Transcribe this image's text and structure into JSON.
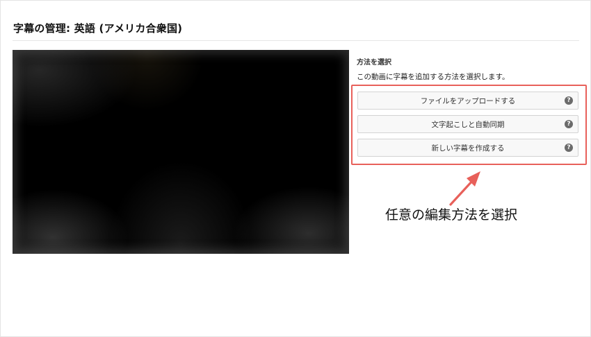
{
  "page": {
    "title": "字幕の管理: 英語 (アメリカ合衆国)"
  },
  "panel": {
    "heading": "方法を選択",
    "description": "この動画に字幕を追加する方法を選択します。",
    "options": [
      {
        "label": "ファイルをアップロードする",
        "icon": "question-mark-icon"
      },
      {
        "label": "文字起こしと自動同期",
        "icon": "question-mark-icon"
      },
      {
        "label": "新しい字幕を作成する",
        "icon": "question-mark-icon"
      }
    ],
    "help_glyph": "?"
  },
  "annotation": {
    "text": "任意の編集方法を選択",
    "color": "#e8605a"
  },
  "colors": {
    "highlight": "#e8605a",
    "button_bg": "#f8f8f8",
    "video_bg": "#000000"
  }
}
